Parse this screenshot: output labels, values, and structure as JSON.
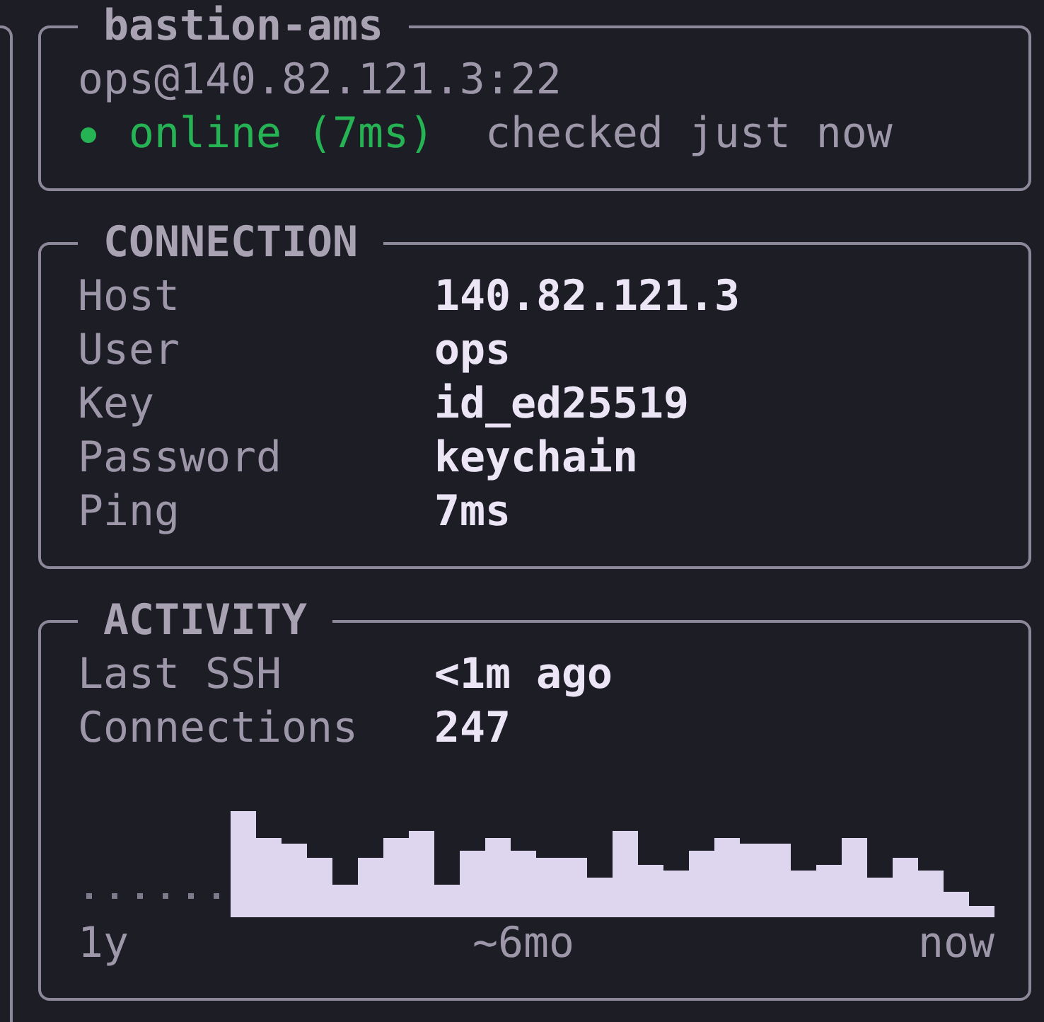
{
  "host_card": {
    "title": "bastion-ams",
    "address": "ops@140.82.121.3:22",
    "status": {
      "kind": "online",
      "label": "online (7ms)",
      "note": "checked just now"
    }
  },
  "sections": [
    {
      "title": "CONNECTION",
      "fields": [
        {
          "label": "Host",
          "value": "140.82.121.3"
        },
        {
          "label": "User",
          "value": "ops"
        },
        {
          "label": "Key",
          "value": "id_ed25519"
        },
        {
          "label": "Password",
          "value": "keychain"
        },
        {
          "label": "Ping",
          "value": "7ms"
        }
      ]
    },
    {
      "title": "ACTIVITY",
      "fields": [
        {
          "label": "Last SSH",
          "value": "<1m ago"
        },
        {
          "label": "Connections",
          "value": "247"
        }
      ],
      "chart": {
        "axis_labels": [
          "1y",
          "~6mo",
          "now"
        ]
      }
    }
  ]
}
